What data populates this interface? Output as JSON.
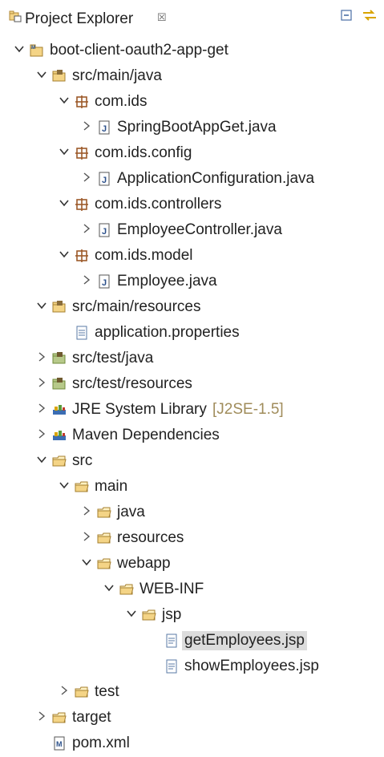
{
  "view": {
    "title": "Project Explorer",
    "close_glyph": "☒"
  },
  "tree": [
    {
      "label": "boot-client-oauth2-app-get",
      "depth": 0,
      "expanded": true,
      "icon": "project"
    },
    {
      "label": "src/main/java",
      "depth": 1,
      "expanded": true,
      "icon": "source-folder"
    },
    {
      "label": "com.ids",
      "depth": 2,
      "expanded": true,
      "icon": "package"
    },
    {
      "label": "SpringBootAppGet.java",
      "depth": 3,
      "expanded": false,
      "icon": "java-file"
    },
    {
      "label": "com.ids.config",
      "depth": 2,
      "expanded": true,
      "icon": "package"
    },
    {
      "label": "ApplicationConfiguration.java",
      "depth": 3,
      "expanded": false,
      "icon": "java-file"
    },
    {
      "label": "com.ids.controllers",
      "depth": 2,
      "expanded": true,
      "icon": "package"
    },
    {
      "label": "EmployeeController.java",
      "depth": 3,
      "expanded": false,
      "icon": "java-file"
    },
    {
      "label": "com.ids.model",
      "depth": 2,
      "expanded": true,
      "icon": "package"
    },
    {
      "label": "Employee.java",
      "depth": 3,
      "expanded": false,
      "icon": "java-file"
    },
    {
      "label": "src/main/resources",
      "depth": 1,
      "expanded": true,
      "icon": "source-folder"
    },
    {
      "label": "application.properties",
      "depth": 2,
      "expanded": null,
      "icon": "text-file"
    },
    {
      "label": "src/test/java",
      "depth": 1,
      "expanded": false,
      "icon": "test-folder"
    },
    {
      "label": "src/test/resources",
      "depth": 1,
      "expanded": false,
      "icon": "test-folder"
    },
    {
      "label": "JRE System Library",
      "decoration": "[J2SE-1.5]",
      "depth": 1,
      "expanded": false,
      "icon": "library"
    },
    {
      "label": "Maven Dependencies",
      "depth": 1,
      "expanded": false,
      "icon": "library"
    },
    {
      "label": "src",
      "depth": 1,
      "expanded": true,
      "icon": "folder"
    },
    {
      "label": "main",
      "depth": 2,
      "expanded": true,
      "icon": "folder"
    },
    {
      "label": "java",
      "depth": 3,
      "expanded": false,
      "icon": "folder"
    },
    {
      "label": "resources",
      "depth": 3,
      "expanded": false,
      "icon": "folder"
    },
    {
      "label": "webapp",
      "depth": 3,
      "expanded": true,
      "icon": "folder"
    },
    {
      "label": "WEB-INF",
      "depth": 4,
      "expanded": true,
      "icon": "folder"
    },
    {
      "label": "jsp",
      "depth": 5,
      "expanded": true,
      "icon": "folder"
    },
    {
      "label": "getEmployees.jsp",
      "depth": 6,
      "expanded": null,
      "icon": "jsp-file",
      "selected": true
    },
    {
      "label": "showEmployees.jsp",
      "depth": 6,
      "expanded": null,
      "icon": "jsp-file"
    },
    {
      "label": "test",
      "depth": 2,
      "expanded": false,
      "icon": "folder"
    },
    {
      "label": "target",
      "depth": 1,
      "expanded": false,
      "icon": "folder"
    },
    {
      "label": "pom.xml",
      "depth": 1,
      "expanded": null,
      "icon": "maven-file"
    }
  ]
}
